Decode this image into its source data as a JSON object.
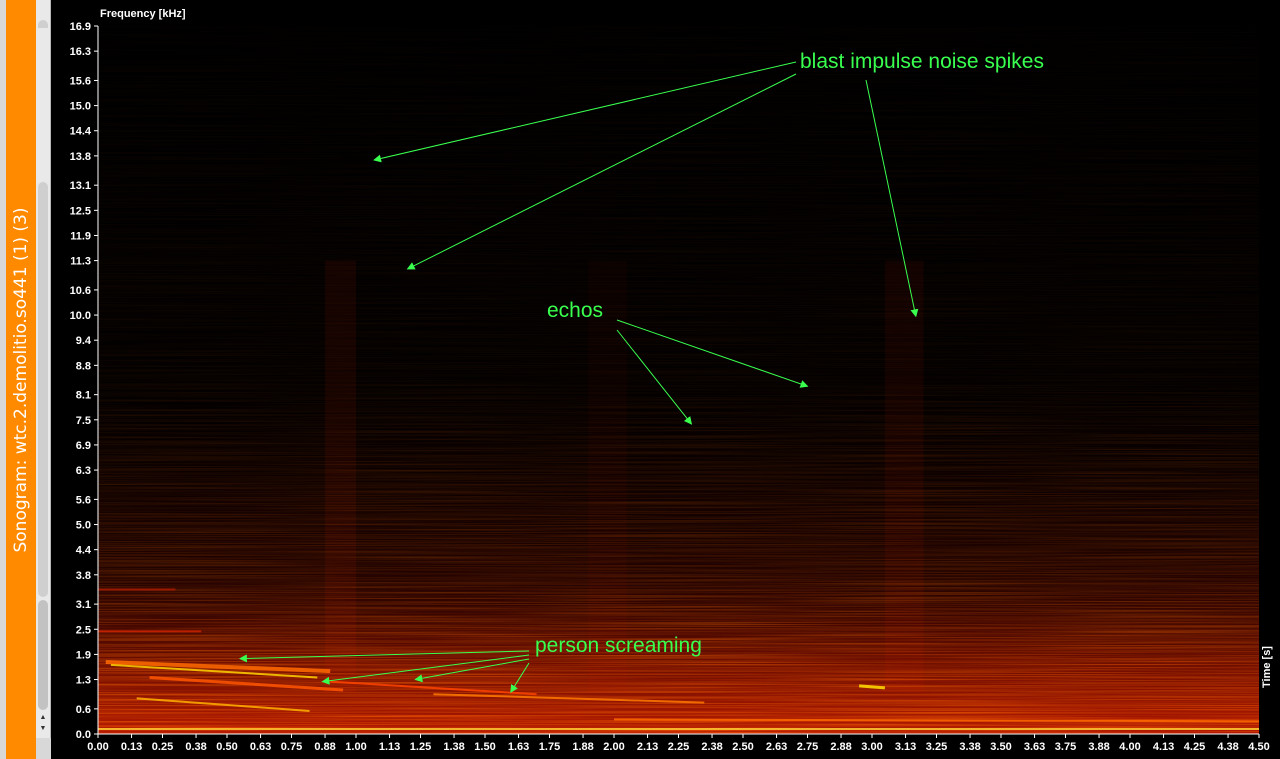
{
  "window": {
    "side_tab_label": "Sonogram: wtc.2.demolitio.so441 (1) (3)",
    "accent_color": "#ff8a00"
  },
  "scrollbar": {
    "up_arrow_icon": "arrow-up-icon",
    "down_arrow_icon": "arrow-down-icon",
    "up_glyph": "▲",
    "down_glyph": "▼"
  },
  "plot": {
    "frequency_axis_title": "Frequency [kHz]",
    "time_axis_title": "Time [s]",
    "colormap": "black-red-orange-yellow-white",
    "background_color": "#000000"
  },
  "annotations": {
    "blast": "blast impulse noise spikes",
    "echos": "echos",
    "scream": "person screaming",
    "color": "#39ff4f"
  },
  "chart_data": {
    "type": "heatmap",
    "xlabel": "Time [s]",
    "ylabel": "Frequency [kHz]",
    "xlim": [
      0,
      4.5
    ],
    "ylim": [
      0,
      16.9
    ],
    "x_ticks": [
      "0.00",
      "0.13",
      "0.25",
      "0.38",
      "0.50",
      "0.63",
      "0.75",
      "0.88",
      "1.00",
      "1.13",
      "1.25",
      "1.38",
      "1.50",
      "1.63",
      "1.75",
      "1.88",
      "2.00",
      "2.13",
      "2.25",
      "2.38",
      "2.50",
      "2.63",
      "2.75",
      "2.88",
      "3.00",
      "3.13",
      "3.25",
      "3.38",
      "3.50",
      "3.63",
      "3.75",
      "3.88",
      "4.00",
      "4.13",
      "4.25",
      "4.38",
      "4.50"
    ],
    "y_ticks": [
      "0.0",
      "0.6",
      "1.3",
      "1.9",
      "2.5",
      "3.1",
      "3.8",
      "4.4",
      "5.0",
      "5.6",
      "6.3",
      "6.9",
      "7.5",
      "8.1",
      "8.8",
      "9.4",
      "10.0",
      "10.6",
      "11.3",
      "11.9",
      "12.5",
      "13.1",
      "13.8",
      "14.4",
      "15.0",
      "15.6",
      "16.3",
      "16.9"
    ],
    "grid": false
  }
}
